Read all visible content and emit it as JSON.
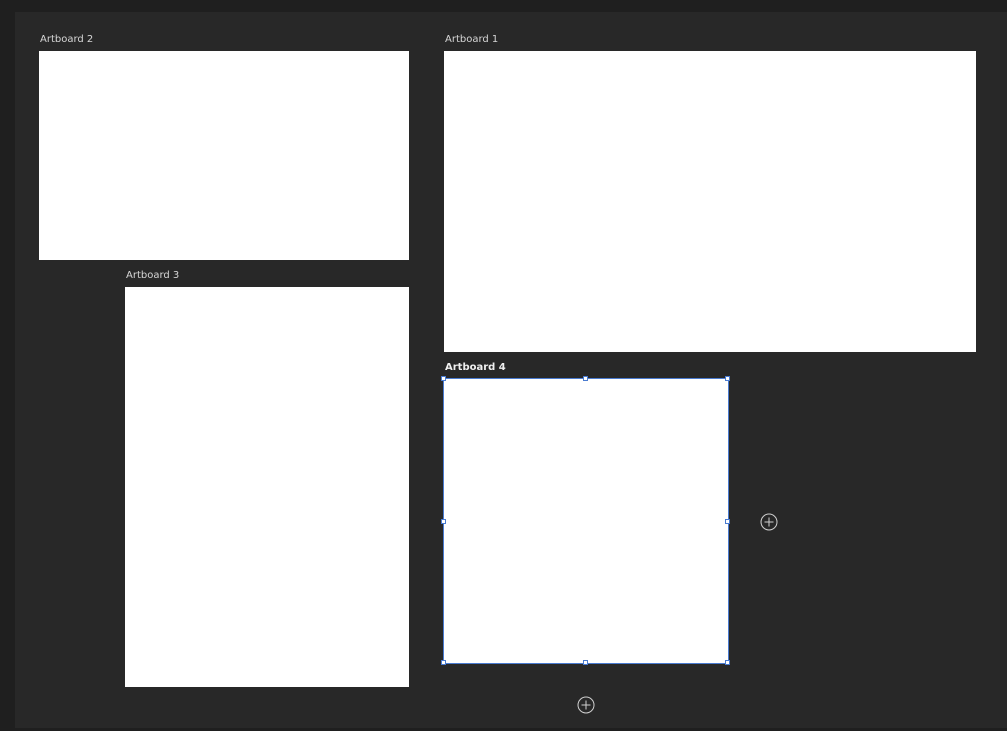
{
  "artboards": {
    "artboard1": {
      "label": "Artboard 1"
    },
    "artboard2": {
      "label": "Artboard 2"
    },
    "artboard3": {
      "label": "Artboard 3"
    },
    "artboard4": {
      "label": "Artboard 4",
      "selected": true
    }
  },
  "add_buttons": {
    "right": {
      "icon": "plus-circle-icon"
    },
    "bottom": {
      "icon": "plus-circle-icon"
    }
  },
  "colors": {
    "canvas_bg": "#282828",
    "outer_bg": "#1f1f1f",
    "artboard_fill": "#ffffff",
    "selection": "#4a7bd0",
    "label": "#d6d6d6"
  }
}
